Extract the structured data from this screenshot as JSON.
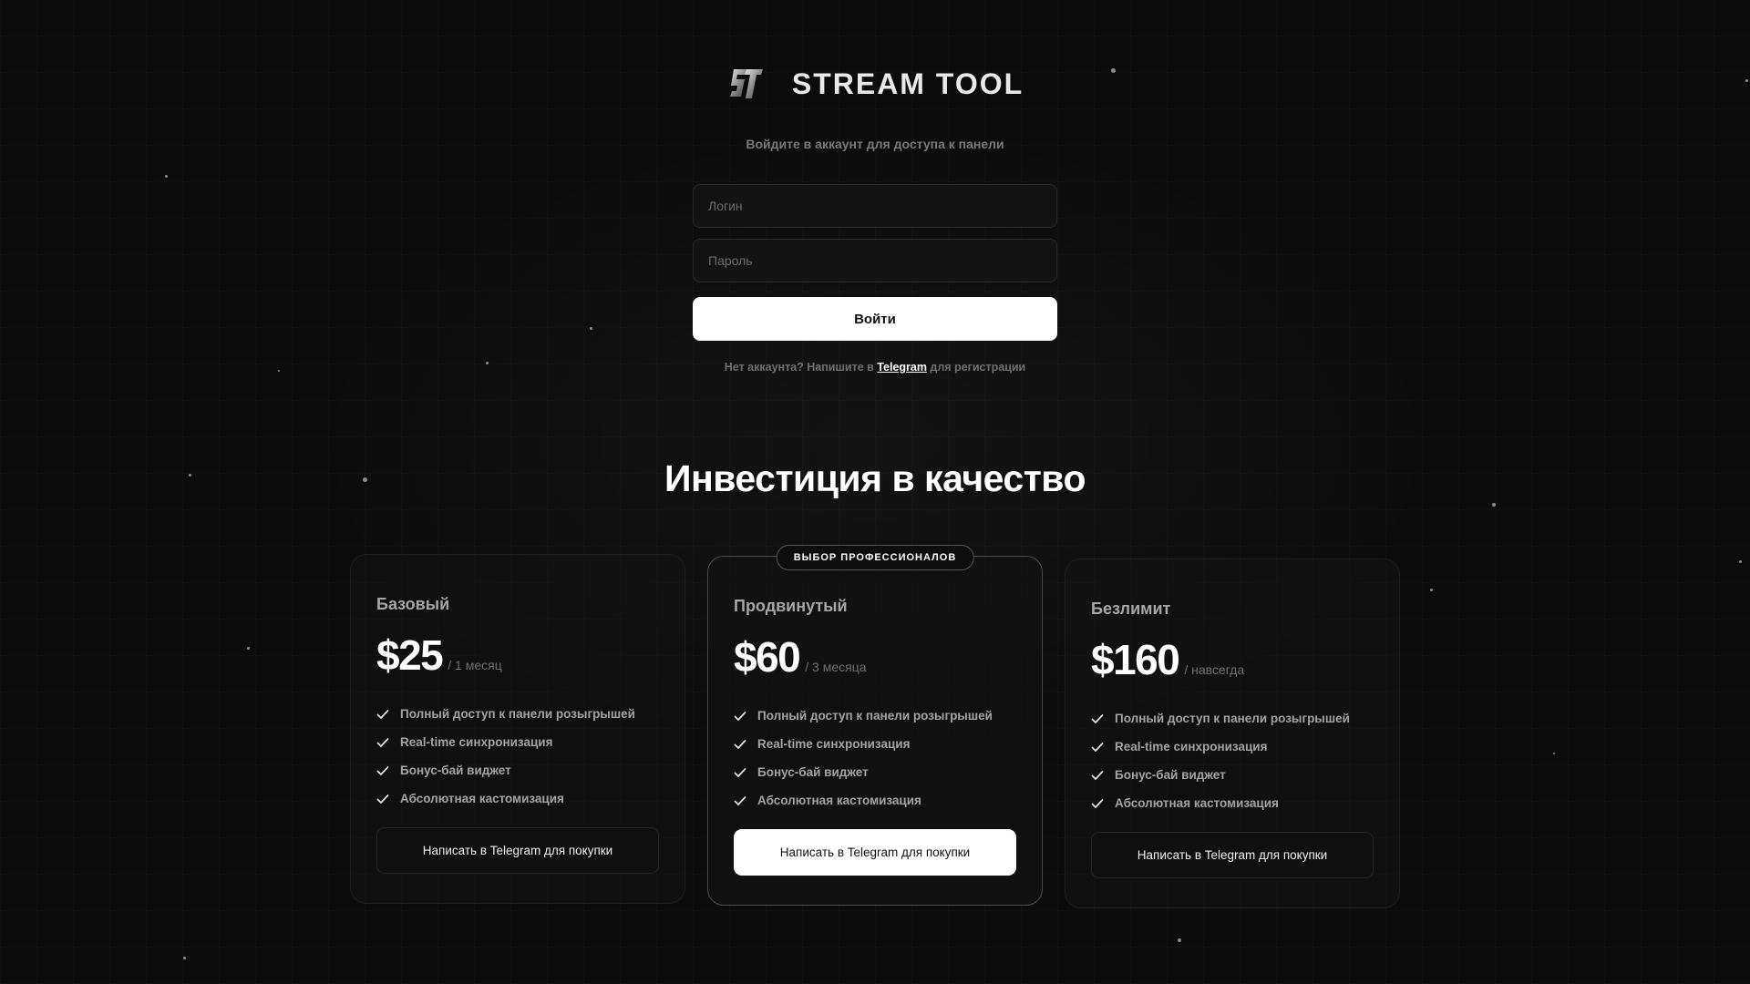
{
  "brand": {
    "title": "STREAM TOOL",
    "logo_icon": "st-logo-icon",
    "subtitle": "Войдите в аккаунт для доступа к панели"
  },
  "login_form": {
    "login_placeholder": "Логин",
    "password_placeholder": "Пароль",
    "submit_label": "Войти",
    "register_prefix": "Нет аккаунта? Напишите в ",
    "register_link": "Telegram",
    "register_suffix": " для регистрации"
  },
  "pricing": {
    "title": "Инвестиция в качество",
    "plans": [
      {
        "name": "Базовый",
        "price": "$25",
        "period": "/ 1 месяц",
        "badge": "",
        "features": [
          "Полный доступ к панели розыгрышей",
          "Real-time синхронизация",
          "Бонус-бай виджет",
          "Абсолютная кастомизация"
        ],
        "button": "Написать в Telegram для покупки"
      },
      {
        "name": "Продвинутый",
        "price": "$60",
        "period": "/ 3 месяца",
        "badge": "ВЫБОР ПРОФЕССИОНАЛОВ",
        "features": [
          "Полный доступ к панели розыгрышей",
          "Real-time синхронизация",
          "Бонус-бай виджет",
          "Абсолютная кастомизация"
        ],
        "button": "Написать в Telegram для покупки"
      },
      {
        "name": "Безлимит",
        "price": "$160",
        "period": "/ навсегда",
        "badge": "",
        "features": [
          "Полный доступ к панели розыгрышей",
          "Real-time синхронизация",
          "Бонус-бай виджет",
          "Абсолютная кастомизация"
        ],
        "button": "Написать в Telegram для покупки"
      }
    ]
  },
  "colors": {
    "background": "#0b0b0b",
    "accent": "#ffffff",
    "muted_text": "#7a7a7a"
  }
}
